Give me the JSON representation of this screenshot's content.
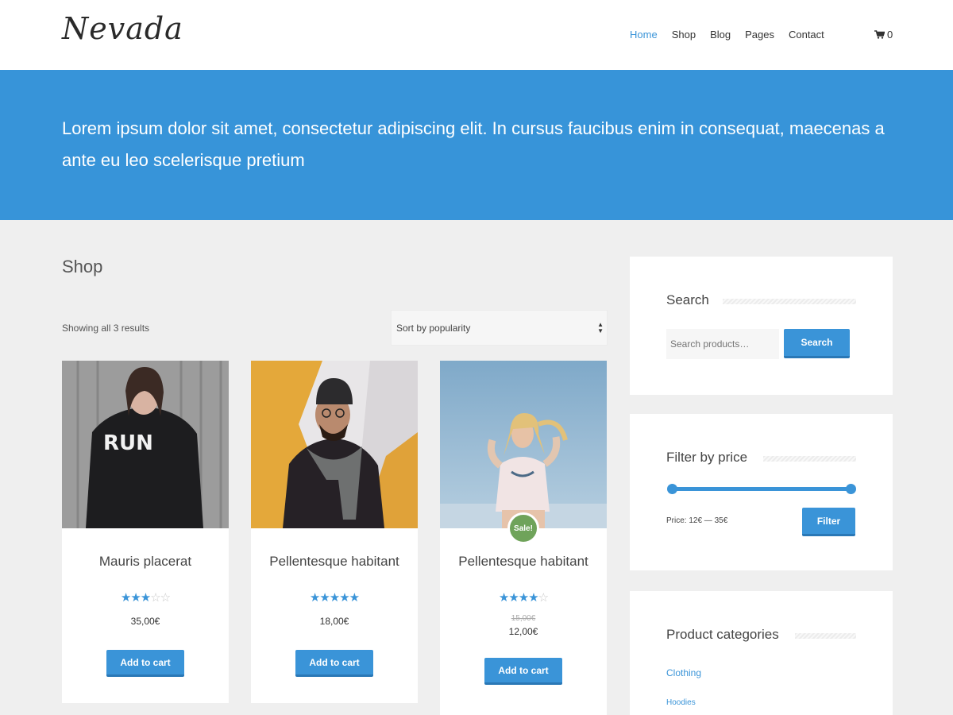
{
  "site": {
    "logo": "Nevada"
  },
  "nav": {
    "items": [
      {
        "label": "Home",
        "active": true
      },
      {
        "label": "Shop",
        "active": false
      },
      {
        "label": "Blog",
        "active": false
      },
      {
        "label": "Pages",
        "active": false
      },
      {
        "label": "Contact",
        "active": false
      }
    ],
    "cart_count": "0",
    "cart_icon": "cart-icon"
  },
  "hero": {
    "text": "Lorem ipsum dolor sit amet, consectetur adipiscing elit. In cursus faucibus enim in consequat, maecenas a ante eu leo scelerisque pretium"
  },
  "shop": {
    "title": "Shop",
    "results": "Showing all 3 results",
    "sort_value": "Sort by popularity"
  },
  "products": [
    {
      "name": "Mauris placerat",
      "rating": 3,
      "price": "35,00€",
      "button": "Add to cart"
    },
    {
      "name": "Pellentesque habitant",
      "rating": 5,
      "price": "18,00€",
      "button": "Add to cart"
    },
    {
      "name": "Pellentesque habitant",
      "rating": 4,
      "old_price": "15,00€",
      "price": "12,00€",
      "sale": "Sale!",
      "button": "Add to cart"
    }
  ],
  "sidebar": {
    "search": {
      "title": "Search",
      "placeholder": "Search products…",
      "button": "Search"
    },
    "filter": {
      "title": "Filter by price",
      "price_label": "Price: 12€ — 35€",
      "button": "Filter"
    },
    "categories": {
      "title": "Product categories",
      "items": [
        "Clothing",
        "Hoodies"
      ]
    }
  },
  "colors": {
    "accent": "#3794d9",
    "sale": "#6fa35a",
    "background": "#efefef"
  }
}
